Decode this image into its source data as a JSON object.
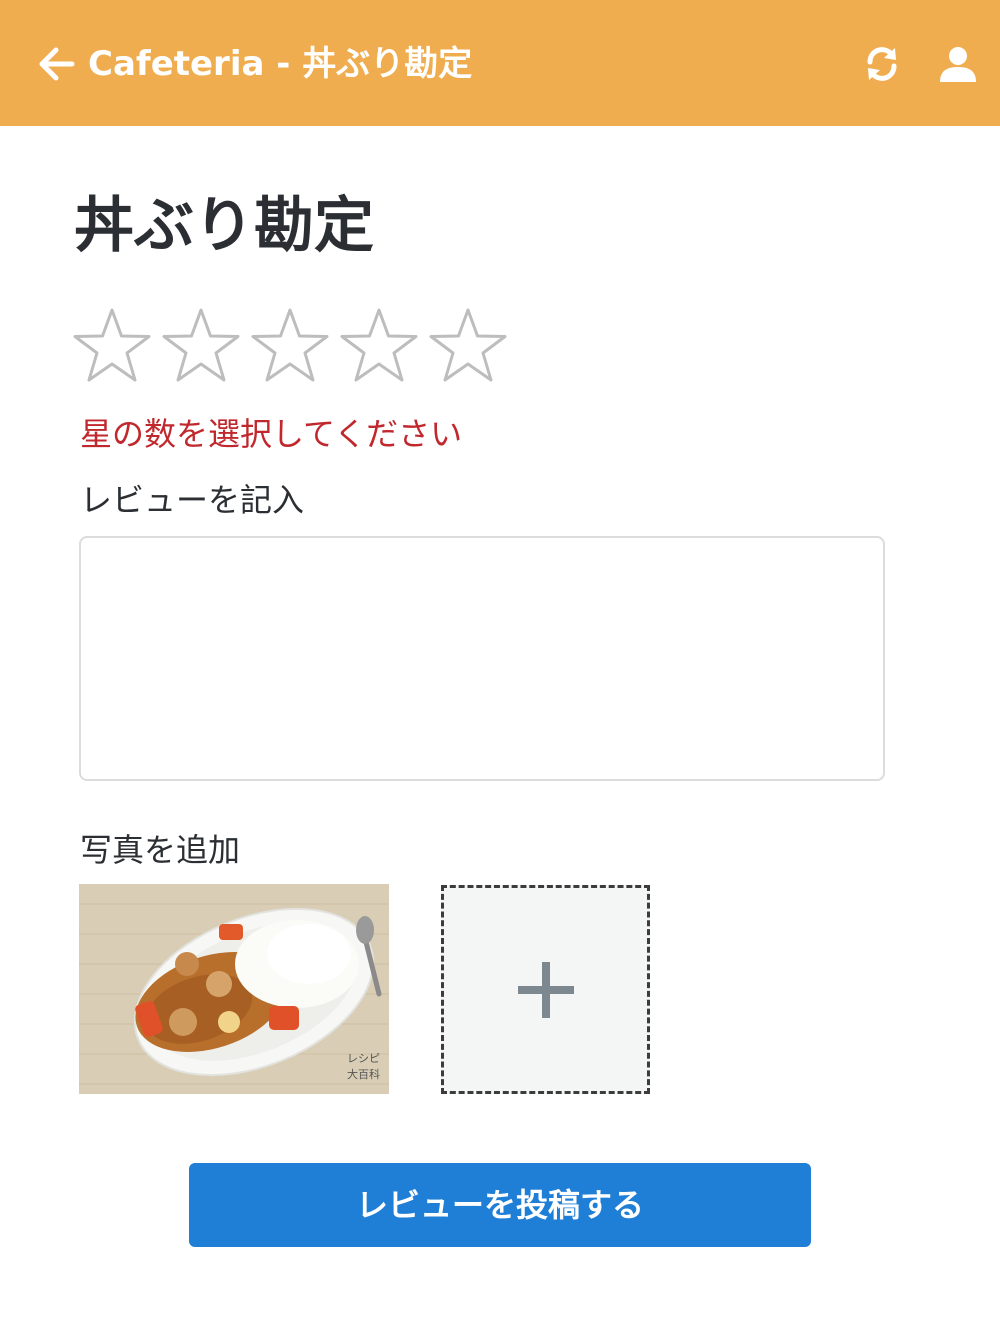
{
  "header": {
    "title": "Cafeteria - 丼ぶり勘定",
    "back_icon": "arrow-left-icon",
    "refresh_icon": "refresh-icon",
    "account_icon": "user-icon",
    "background_color": "#efad4f"
  },
  "main": {
    "page_title": "丼ぶり勘定",
    "rating": {
      "max_stars": 5,
      "selected": 0,
      "icon": "star-outline-icon"
    },
    "rating_error": "星の数を選択してください",
    "review_label": "レビューを記入",
    "review_value": "",
    "photo_label": "写真を追加",
    "photos": [
      {
        "description_icon": "curry-rice-photo"
      }
    ],
    "add_photo_icon": "plus-icon",
    "submit_label": "レビューを投稿する"
  },
  "colors": {
    "error": "#c0282d",
    "primary_button": "#1f7ed6",
    "text": "#2b2f33"
  }
}
